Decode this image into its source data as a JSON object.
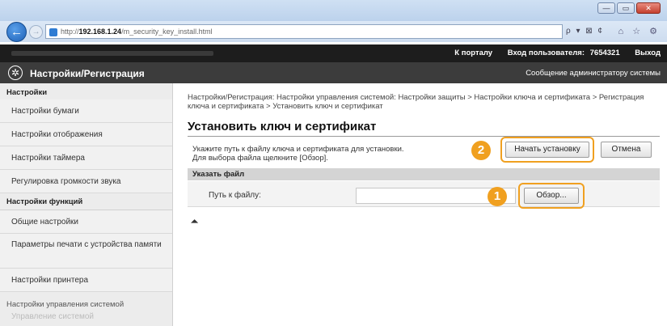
{
  "browser": {
    "url_prefix": "http://",
    "url_host": "192.168.1.24",
    "url_path": "/m_security_key_install.html",
    "addr_tools": "ρ ▾ ⊠ ¢",
    "star_tools": "⌂ ☆ ⚙",
    "win_min": "—",
    "win_max": "▭",
    "win_close": "✕",
    "back": "←",
    "fwd": "→"
  },
  "topbar": {
    "portal_link": "К порталу",
    "login_label": "Вход пользователя:",
    "login_id": "7654321",
    "logout": "Выход"
  },
  "header": {
    "icon": "gear-icon",
    "icon_glyph": "✲",
    "title": "Настройки/Регистрация",
    "message": "Сообщение администратору системы"
  },
  "sidebar": {
    "section1": "Настройки",
    "items1": [
      "Настройки бумаги",
      "Настройки отображения",
      "Настройки таймера",
      "Регулировка громкости звука"
    ],
    "section2": "Настройки функций",
    "items2": [
      "Общие настройки",
      "Параметры печати с устройства памяти",
      "Настройки принтера"
    ],
    "section3": "Настройки управления системой",
    "faded": "Управление системой"
  },
  "main": {
    "breadcrumb": "Настройки/Регистрация: Настройки управления системой: Настройки защиты > Настройки ключа и сертификата > Регистрация ключа и сертификата > Установить ключ и сертификат",
    "title": "Установить ключ и сертификат",
    "instr_line1": "Укажите путь к файлу ключа и сертификата для установки.",
    "instr_line2": "Для выбора файла щелкните [Обзор].",
    "start_button": "Начать установку",
    "cancel_button": "Отмена",
    "specify_file_header": "Указать файл",
    "file_path_label": "Путь к файлу:",
    "file_path_value": "",
    "browse_button": "Обзор...",
    "badge_1": "1",
    "badge_2": "2",
    "to_top": "⏶"
  },
  "colors": {
    "highlight": "#f0a020",
    "header_bg": "#3c3c3c",
    "topbar_bg": "#1d1d1d"
  }
}
